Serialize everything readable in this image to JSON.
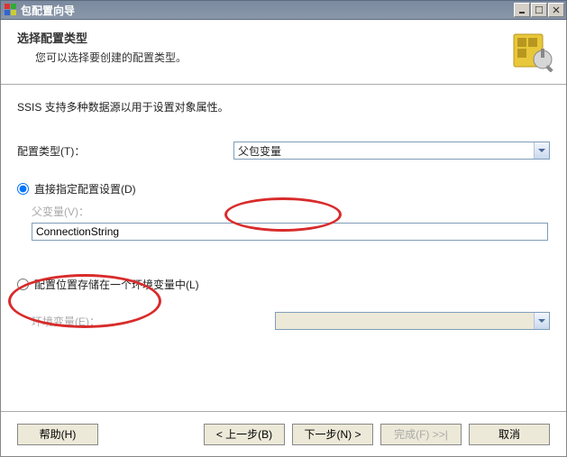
{
  "window": {
    "title": "包配置向导"
  },
  "header": {
    "title": "选择配置类型",
    "subtitle": "您可以选择要创建的配置类型。"
  },
  "content": {
    "description": "SSIS 支持多种数据源以用于设置对象属性。",
    "configTypeLabel": "配置类型(T)：",
    "configTypeValue": "父包变量",
    "radioDirectLabel": "直接指定配置设置(D)",
    "parentVarLabel": "父变量(V)：",
    "parentVarValue": "ConnectionString",
    "radioEnvLabel": "配置位置存储在一个环境变量中(L)",
    "envVarLabel": "环境变量(E)："
  },
  "buttons": {
    "help": "帮助(H)",
    "back": "< 上一步(B)",
    "next": "下一步(N) >",
    "finish": "完成(F) >>|",
    "cancel": "取消"
  }
}
